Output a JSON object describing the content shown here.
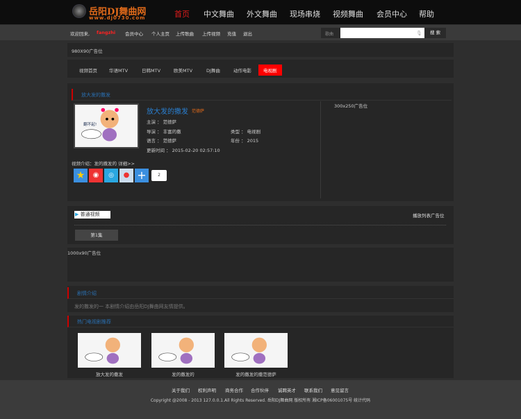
{
  "header": {
    "logo_text": "岳阳DJ舞曲网",
    "logo_url": "www.dj0730.com",
    "nav": [
      "首页",
      "中文舞曲",
      "外文舞曲",
      "现场串烧",
      "视频舞曲",
      "会员中心",
      "帮助"
    ]
  },
  "subbar": {
    "welcome": "欢迎回来,",
    "username": "fangzhi",
    "links": [
      "会员中心",
      "个人主页",
      "上传歌曲",
      "上传视频",
      "充值",
      "退出"
    ],
    "search_label": "歌曲",
    "search_value": "",
    "search_button": "搜 索"
  },
  "ad_top": "980X90广告位",
  "categories": [
    "视频首页",
    "华语MTV",
    "日韩MTV",
    "欧美MTV",
    "DJ舞曲",
    "动作电影",
    "电视剧"
  ],
  "detail": {
    "section_title": "放大发的撒发",
    "title": "放大发的撒发",
    "tag": "范德萨",
    "fields": [
      {
        "label": "主演",
        "value": "范德萨"
      },
      {
        "label": "导演",
        "value": "丰富的撒"
      },
      {
        "label": "类型",
        "value": "电视剧"
      },
      {
        "label": "语言",
        "value": "范德萨"
      },
      {
        "label": "年份",
        "value": "2015"
      },
      {
        "label": "更新时间",
        "value": "2015-02-20 02:57:10"
      }
    ],
    "intro": "视频介绍：发的撒发的 详细>>",
    "share_count": "2",
    "ad_side": "300x250广告位"
  },
  "player": {
    "source": "普通视频",
    "ad": "播放列表广告位",
    "episodes": [
      "第1集"
    ]
  },
  "ad_mid": "1000x90广告位",
  "synopsis": {
    "title": "剧情介绍",
    "text": "发的撒发的一 本剧情介绍由岳阳DJ舞曲网友情提供。"
  },
  "hot": {
    "title": "热门电视剧推荐",
    "items": [
      "放大发的撒发",
      "发的撒发的",
      "发的撒发的撒范德萨"
    ]
  },
  "footer": {
    "links": [
      "关于我们",
      "权利声明",
      "商务合作",
      "合作伙伴",
      "诚聘英才",
      "联系我们",
      "意见留言"
    ],
    "copyright": "Copyright @2008 - 2013 127.0.0.1.All Rights Reserved. 岳阳DJ舞曲网 版权所有 湘ICP备06001075号 统计代码"
  }
}
